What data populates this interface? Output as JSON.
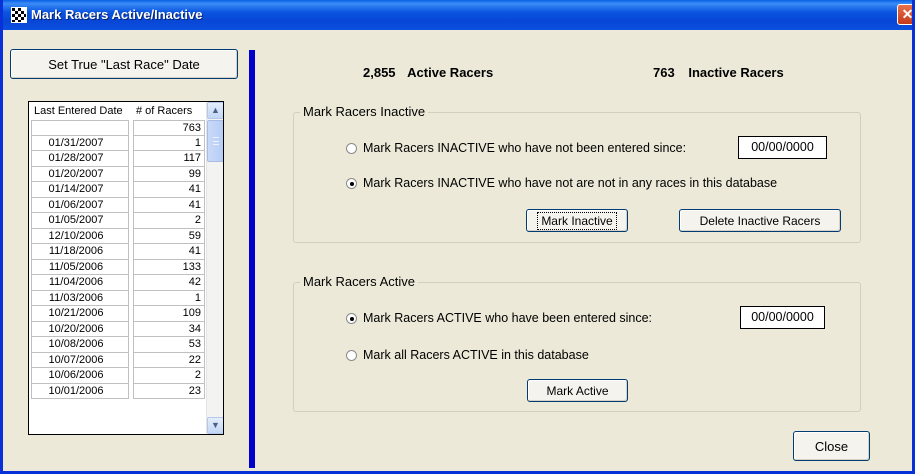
{
  "window": {
    "title": "Mark Racers Active/Inactive",
    "close_glyph": "✕"
  },
  "left": {
    "set_last_race_button": "Set True \"Last Race\" Date",
    "list": {
      "columns": [
        "Last Entered Date",
        "# of Racers"
      ],
      "rows": [
        [
          "",
          "763"
        ],
        [
          "01/31/2007",
          "1"
        ],
        [
          "01/28/2007",
          "117"
        ],
        [
          "01/20/2007",
          "99"
        ],
        [
          "01/14/2007",
          "41"
        ],
        [
          "01/06/2007",
          "41"
        ],
        [
          "01/05/2007",
          "2"
        ],
        [
          "12/10/2006",
          "59"
        ],
        [
          "11/18/2006",
          "41"
        ],
        [
          "11/05/2006",
          "133"
        ],
        [
          "11/04/2006",
          "42"
        ],
        [
          "11/03/2006",
          "1"
        ],
        [
          "10/21/2006",
          "109"
        ],
        [
          "10/20/2006",
          "34"
        ],
        [
          "10/08/2006",
          "53"
        ],
        [
          "10/07/2006",
          "22"
        ],
        [
          "10/06/2006",
          "2"
        ],
        [
          "10/01/2006",
          "23"
        ]
      ],
      "scroll_up": "▲",
      "scroll_down": "▼"
    }
  },
  "stats": {
    "active_count": "2,855",
    "active_label": "Active Racers",
    "inactive_count": "763",
    "inactive_label": "Inactive Racers"
  },
  "inactive_group": {
    "legend": "Mark Racers Inactive",
    "option1": "Mark Racers INACTIVE who have not been entered since:",
    "option1_date": "00/00/0000",
    "option2": "Mark Racers INACTIVE who have not are not in any races in this database",
    "selected": "option2",
    "mark_inactive_button": "Mark Inactive",
    "delete_inactive_button": "Delete Inactive Racers"
  },
  "active_group": {
    "legend": "Mark Racers Active",
    "option1": "Mark Racers ACTIVE who have been entered since:",
    "option1_date": "00/00/0000",
    "option2": "Mark all Racers ACTIVE in this database",
    "selected": "option1",
    "mark_active_button": "Mark Active"
  },
  "close_button": "Close",
  "colors": {
    "title_bar": "#0a50de",
    "divider": "#0000cc",
    "window_bg": "#ece9d8"
  }
}
